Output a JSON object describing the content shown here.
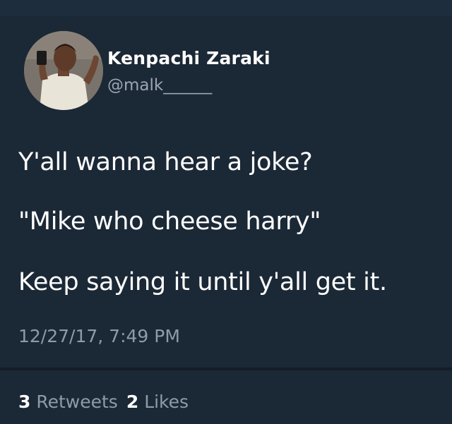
{
  "tweet": {
    "author_name": "Kenpachi Zaraki",
    "author_handle": "@malk______",
    "lines": [
      "Y'all wanna hear a joke?",
      "\"Mike who cheese harry\"",
      "Keep saying it until y'all get it."
    ],
    "timestamp": "12/27/17, 7:49 PM",
    "retweets_count": "3",
    "retweets_label": "Retweets",
    "likes_count": "2",
    "likes_label": "Likes"
  },
  "colors": {
    "background": "#1b2836",
    "text": "#ffffff",
    "muted_text": "#8f9ba8"
  }
}
